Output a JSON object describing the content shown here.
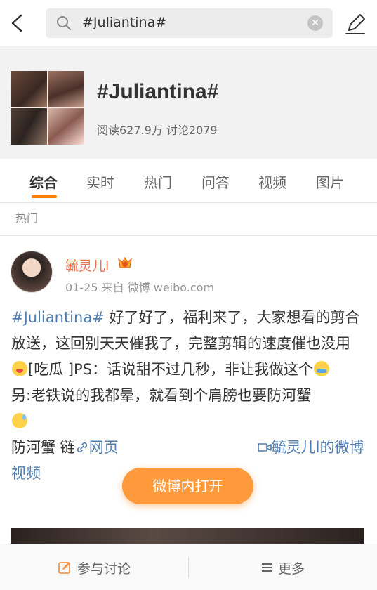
{
  "search": {
    "query": "#Juliantina#",
    "clear_symbol": "✕"
  },
  "topic": {
    "title": "#Juliantina#",
    "stats": "阅读627.9万 讨论2079"
  },
  "tabs": [
    {
      "label": "综合",
      "active": true
    },
    {
      "label": "实时",
      "active": false
    },
    {
      "label": "热门",
      "active": false
    },
    {
      "label": "问答",
      "active": false
    },
    {
      "label": "视频",
      "active": false
    },
    {
      "label": "图片",
      "active": false
    }
  ],
  "section_label": "热门",
  "post": {
    "author": "毓灵儿l",
    "meta": "01-25 来自 微博 weibo.com",
    "tag": "#Juliantina#",
    "text1": " 好了好了，福利来了，大家想看的剪合放送，这回别天天催我了，完整剪辑的速度催也没用",
    "text2": "[吃瓜 ]PS：话说甜不过几秒，非让我做这个",
    "text3": "另:老铁说的我都晕，就看到个肩膀也要防河蟹",
    "text4": "防河蟹 链",
    "link1": "网页",
    "link2": "毓灵儿l的微博视频"
  },
  "open_button": "微博内打开",
  "bottom": {
    "discuss": "参与讨论",
    "more": "更多"
  },
  "colors": {
    "accent": "#ff8200",
    "link": "#507daf",
    "author": "#eb7350"
  }
}
